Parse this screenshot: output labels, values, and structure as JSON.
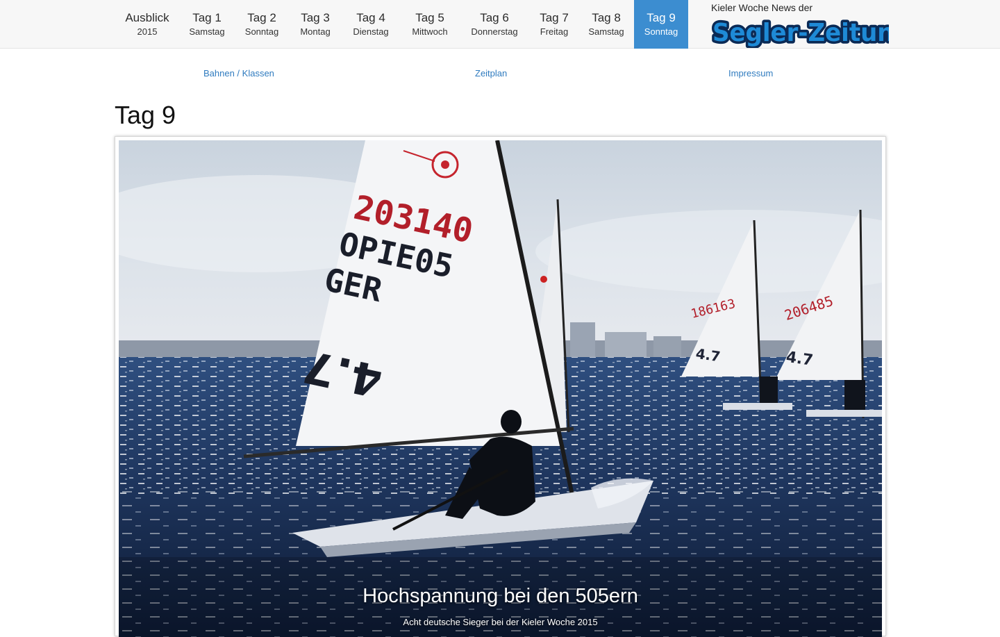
{
  "nav": {
    "tabs": [
      {
        "label": "Ausblick",
        "sub": "2015"
      },
      {
        "label": "Tag 1",
        "sub": "Samstag"
      },
      {
        "label": "Tag 2",
        "sub": "Sonntag"
      },
      {
        "label": "Tag 3",
        "sub": "Montag"
      },
      {
        "label": "Tag 4",
        "sub": "Dienstag"
      },
      {
        "label": "Tag 5",
        "sub": "Mittwoch"
      },
      {
        "label": "Tag 6",
        "sub": "Donnerstag"
      },
      {
        "label": "Tag 7",
        "sub": "Freitag"
      },
      {
        "label": "Tag 8",
        "sub": "Samstag"
      },
      {
        "label": "Tag 9",
        "sub": "Sonntag",
        "active": true
      }
    ],
    "active_color": "#3c8dd0"
  },
  "brand": {
    "kicker": "Kieler Woche News der",
    "logo_text": "Segler-Zeitung",
    "logo_color": "#1e8ad6"
  },
  "subnav": {
    "links": [
      "Bahnen / Klassen",
      "Zeitplan",
      "Impressum"
    ],
    "link_color": "#2f7bbf"
  },
  "page": {
    "title": "Tag 9"
  },
  "hero": {
    "headline": "Hochspannung bei den 505ern",
    "subline": "Acht deutsche Sieger bei der Kieler Woche 2015",
    "image": {
      "sail_main_number": "203140",
      "sail_line2": "OPIE05",
      "sail_nation": "GER",
      "sail_class": "4.7",
      "sail_right_number": "206485",
      "sail_mid_number": "186163"
    }
  }
}
